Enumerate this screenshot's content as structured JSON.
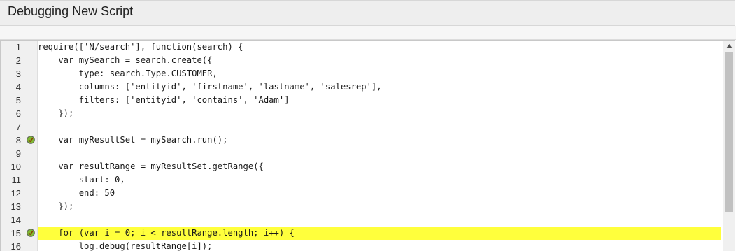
{
  "window": {
    "title": "Debugging New Script"
  },
  "editor": {
    "lines": [
      {
        "num": "1",
        "code": "require(['N/search'], function(search) {",
        "breakpoint": false,
        "highlight": false
      },
      {
        "num": "2",
        "code": "    var mySearch = search.create({",
        "breakpoint": false,
        "highlight": false
      },
      {
        "num": "3",
        "code": "        type: search.Type.CUSTOMER,",
        "breakpoint": false,
        "highlight": false
      },
      {
        "num": "4",
        "code": "        columns: ['entityid', 'firstname', 'lastname', 'salesrep'],",
        "breakpoint": false,
        "highlight": false
      },
      {
        "num": "5",
        "code": "        filters: ['entityid', 'contains', 'Adam']",
        "breakpoint": false,
        "highlight": false
      },
      {
        "num": "6",
        "code": "    });",
        "breakpoint": false,
        "highlight": false
      },
      {
        "num": "7",
        "code": "",
        "breakpoint": false,
        "highlight": false
      },
      {
        "num": "8",
        "code": "    var myResultSet = mySearch.run();",
        "breakpoint": true,
        "highlight": false
      },
      {
        "num": "9",
        "code": "",
        "breakpoint": false,
        "highlight": false
      },
      {
        "num": "10",
        "code": "    var resultRange = myResultSet.getRange({",
        "breakpoint": false,
        "highlight": false
      },
      {
        "num": "11",
        "code": "        start: 0,",
        "breakpoint": false,
        "highlight": false
      },
      {
        "num": "12",
        "code": "        end: 50",
        "breakpoint": false,
        "highlight": false
      },
      {
        "num": "13",
        "code": "    });",
        "breakpoint": false,
        "highlight": false
      },
      {
        "num": "14",
        "code": "",
        "breakpoint": false,
        "highlight": false
      },
      {
        "num": "15",
        "code": "    for (var i = 0; i < resultRange.length; i++) {",
        "breakpoint": true,
        "highlight": true
      },
      {
        "num": "16",
        "code": "        log.debug(resultRange[i]);",
        "breakpoint": false,
        "highlight": false
      }
    ]
  },
  "colors": {
    "highlight": "#ffff3c",
    "breakpoint": "#7fb832"
  },
  "icons": {
    "breakpoint": "breakpoint-check-icon",
    "scroll_up": "scroll-up-arrow-icon"
  }
}
